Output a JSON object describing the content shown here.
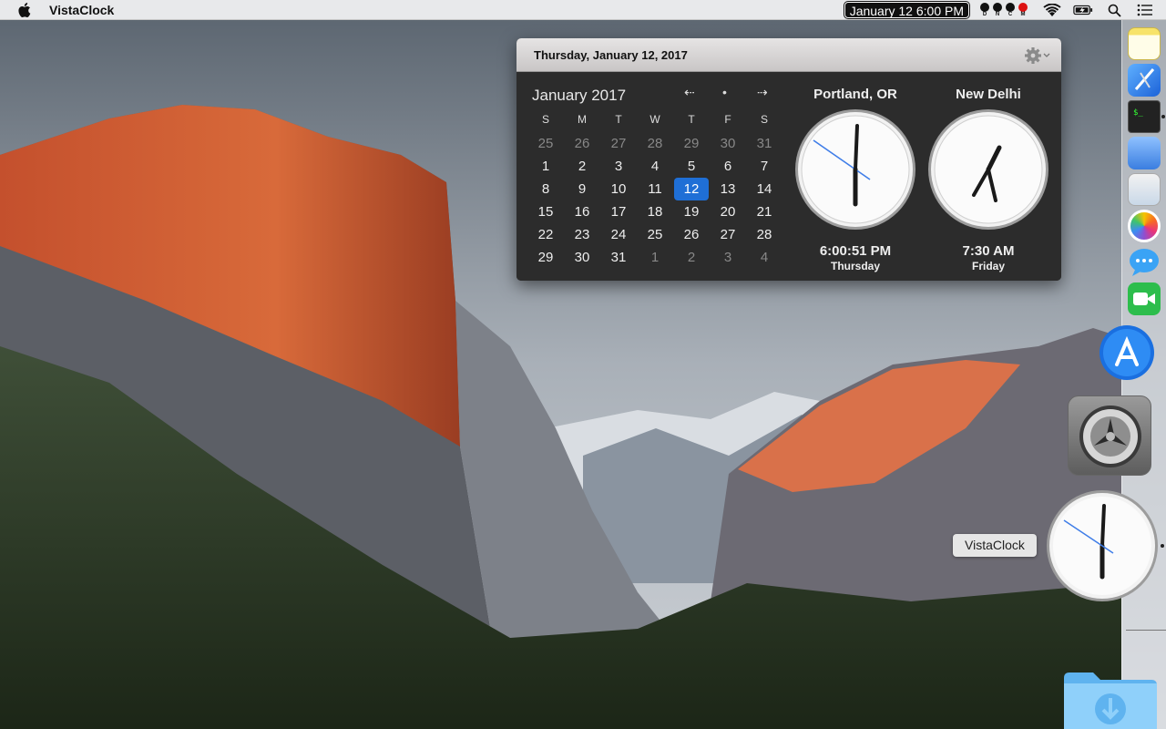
{
  "menubar": {
    "app_name": "VistaClock",
    "clock": "January 12  6:00 PM",
    "status_letters": [
      "D",
      "N",
      "C",
      "M"
    ]
  },
  "popup": {
    "header_date": "Thursday, January 12, 2017",
    "calendar": {
      "title": "January 2017",
      "prev": "⇠",
      "today_btn": "•",
      "next": "⇢",
      "weekdays": [
        "S",
        "M",
        "T",
        "W",
        "T",
        "F",
        "S"
      ],
      "weeks": [
        [
          "25",
          "26",
          "27",
          "28",
          "29",
          "30",
          "31"
        ],
        [
          "1",
          "2",
          "3",
          "4",
          "5",
          "6",
          "7"
        ],
        [
          "8",
          "9",
          "10",
          "11",
          "12",
          "13",
          "14"
        ],
        [
          "15",
          "16",
          "17",
          "18",
          "19",
          "20",
          "21"
        ],
        [
          "22",
          "23",
          "24",
          "25",
          "26",
          "27",
          "28"
        ],
        [
          "29",
          "30",
          "31",
          "1",
          "2",
          "3",
          "4"
        ]
      ],
      "today": "12"
    },
    "clocks": [
      {
        "city": "Portland, OR",
        "time": "6:00:51 PM",
        "day": "Thursday"
      },
      {
        "city": "New Delhi",
        "time": "7:30 AM",
        "day": "Friday"
      }
    ]
  },
  "dock": {
    "items": [
      "notes-icon",
      "xcode-icon",
      "terminal-icon",
      "preview-icon",
      "image-capture-icon",
      "photos-icon",
      "messages-icon",
      "facetime-icon",
      "app-store-icon",
      "system-preferences-icon",
      "vistaclock-icon",
      "downloads-folder-icon"
    ],
    "tooltip": "VistaClock"
  },
  "colors": {
    "accent": "#1f6fd6",
    "popup_bg": "#2c2c2c"
  }
}
